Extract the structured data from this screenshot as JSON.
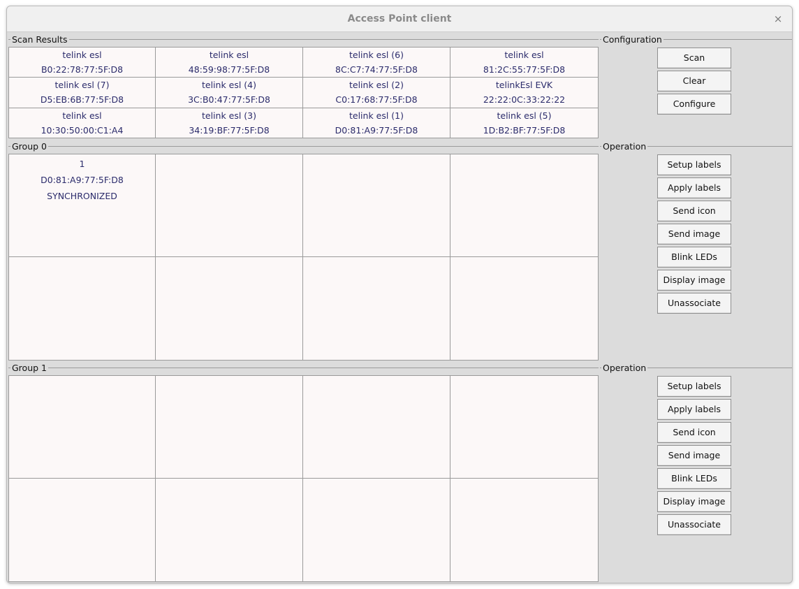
{
  "window": {
    "title": "Access Point client",
    "close_icon": "×"
  },
  "scan": {
    "label": "Scan Results",
    "devices": [
      {
        "name": "telink esl",
        "mac": "B0:22:78:77:5F:D8"
      },
      {
        "name": "telink esl",
        "mac": "48:59:98:77:5F:D8"
      },
      {
        "name": "telink esl (6)",
        "mac": "8C:C7:74:77:5F:D8"
      },
      {
        "name": "telink esl",
        "mac": "81:2C:55:77:5F:D8"
      },
      {
        "name": "telink esl (7)",
        "mac": "D5:EB:6B:77:5F:D8"
      },
      {
        "name": "telink esl (4)",
        "mac": "3C:B0:47:77:5F:D8"
      },
      {
        "name": "telink esl (2)",
        "mac": "C0:17:68:77:5F:D8"
      },
      {
        "name": "telinkEsl EVK",
        "mac": "22:22:0C:33:22:22"
      },
      {
        "name": "telink esl",
        "mac": "10:30:50:00:C1:A4"
      },
      {
        "name": "telink esl (3)",
        "mac": "34:19:BF:77:5F:D8"
      },
      {
        "name": "telink esl (1)",
        "mac": "D0:81:A9:77:5F:D8"
      },
      {
        "name": "telink esl (5)",
        "mac": "1D:B2:BF:77:5F:D8"
      }
    ]
  },
  "configuration": {
    "label": "Configuration",
    "buttons": [
      "Scan",
      "Clear",
      "Configure"
    ]
  },
  "groups": [
    {
      "label": "Group 0",
      "operation_label": "Operation",
      "cells": [
        {
          "id": "1",
          "mac": "D0:81:A9:77:5F:D8",
          "status": "SYNCHRONIZED"
        },
        {},
        {},
        {},
        {},
        {},
        {},
        {}
      ],
      "buttons": [
        "Setup labels",
        "Apply labels",
        "Send icon",
        "Send image",
        "Blink LEDs",
        "Display image",
        "Unassociate"
      ]
    },
    {
      "label": "Group 1",
      "operation_label": "Operation",
      "cells": [
        {},
        {},
        {},
        {},
        {},
        {},
        {},
        {}
      ],
      "buttons": [
        "Setup labels",
        "Apply labels",
        "Send icon",
        "Send image",
        "Blink LEDs",
        "Display image",
        "Unassociate"
      ]
    }
  ],
  "colors": {
    "cell_text": "#2b2b6b",
    "cell_bg": "#fcf8f8",
    "window_bg": "#dcdcdc"
  }
}
